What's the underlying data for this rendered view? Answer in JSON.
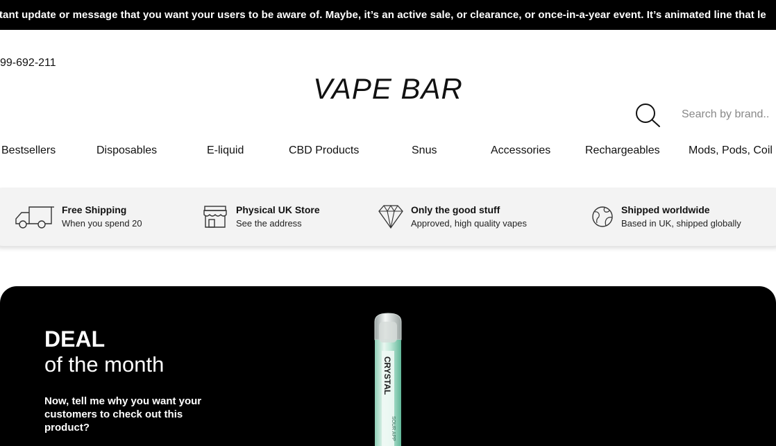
{
  "announcement": {
    "text": "rtant update or message that you want your users to be aware of. Maybe, it’s an active sale, or clearance, or once-in-a-year event. It’s animated line that le"
  },
  "header": {
    "phone": "99-692-211",
    "logo": "VAPE BAR",
    "search": {
      "placeholder": "Search by brand.."
    }
  },
  "nav": {
    "items": [
      {
        "label": "Bestsellers"
      },
      {
        "label": "Disposables"
      },
      {
        "label": "E-liquid"
      },
      {
        "label": "CBD Products"
      },
      {
        "label": "Snus"
      },
      {
        "label": "Accessories"
      },
      {
        "label": "Rechargeables"
      },
      {
        "label": "Mods, Pods, Coil"
      }
    ]
  },
  "features": [
    {
      "icon": "truck-icon",
      "title": "Free Shipping",
      "subtitle": "When you spend 20"
    },
    {
      "icon": "store-icon",
      "title": "Physical UK Store",
      "subtitle": "See the address"
    },
    {
      "icon": "diamond-icon",
      "title": "Only the good stuff",
      "subtitle": "Approved, high quality vapes"
    },
    {
      "icon": "globe-icon",
      "title": "Shipped worldwide",
      "subtitle": "Based in UK, shipped globally"
    }
  ],
  "deal": {
    "heading_bold": "DEAL",
    "heading_light": "of the month",
    "description": "Now, tell me why you want your customers to check out this product?",
    "product_brand": "CRYSTAL",
    "product_flavor": "SOUR APP"
  },
  "colors": {
    "announcement_bg": "#000000",
    "feature_bar_bg": "#f3f3f3",
    "deal_bg": "#000000",
    "product_accent": "#7fd6b8"
  }
}
